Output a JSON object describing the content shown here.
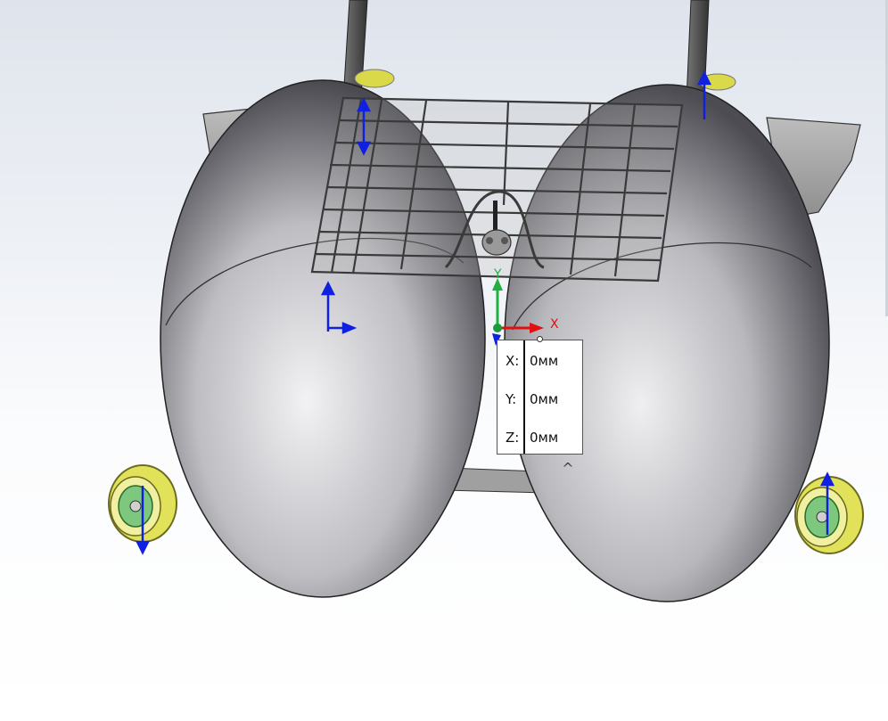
{
  "viewport": {
    "model": "catamaran-assembly",
    "triad": {
      "x_label": "X",
      "y_label": "Y"
    }
  },
  "coordinate_box": {
    "rows": [
      {
        "axis": "X:",
        "value": "0мм"
      },
      {
        "axis": "Y:",
        "value": "0мм"
      },
      {
        "axis": "Z:",
        "value": "0мм"
      }
    ],
    "collapse_icon": "chevron-up-icon",
    "collapse_glyph": "^"
  },
  "colors": {
    "hull": "#a9a9ad",
    "frame": "#4a4a4a",
    "deck": "#b9b9b9",
    "wheel": "#e3e35a",
    "axis_blue": "#1020e0",
    "axis_red": "#e01010",
    "axis_green": "#20b040"
  }
}
